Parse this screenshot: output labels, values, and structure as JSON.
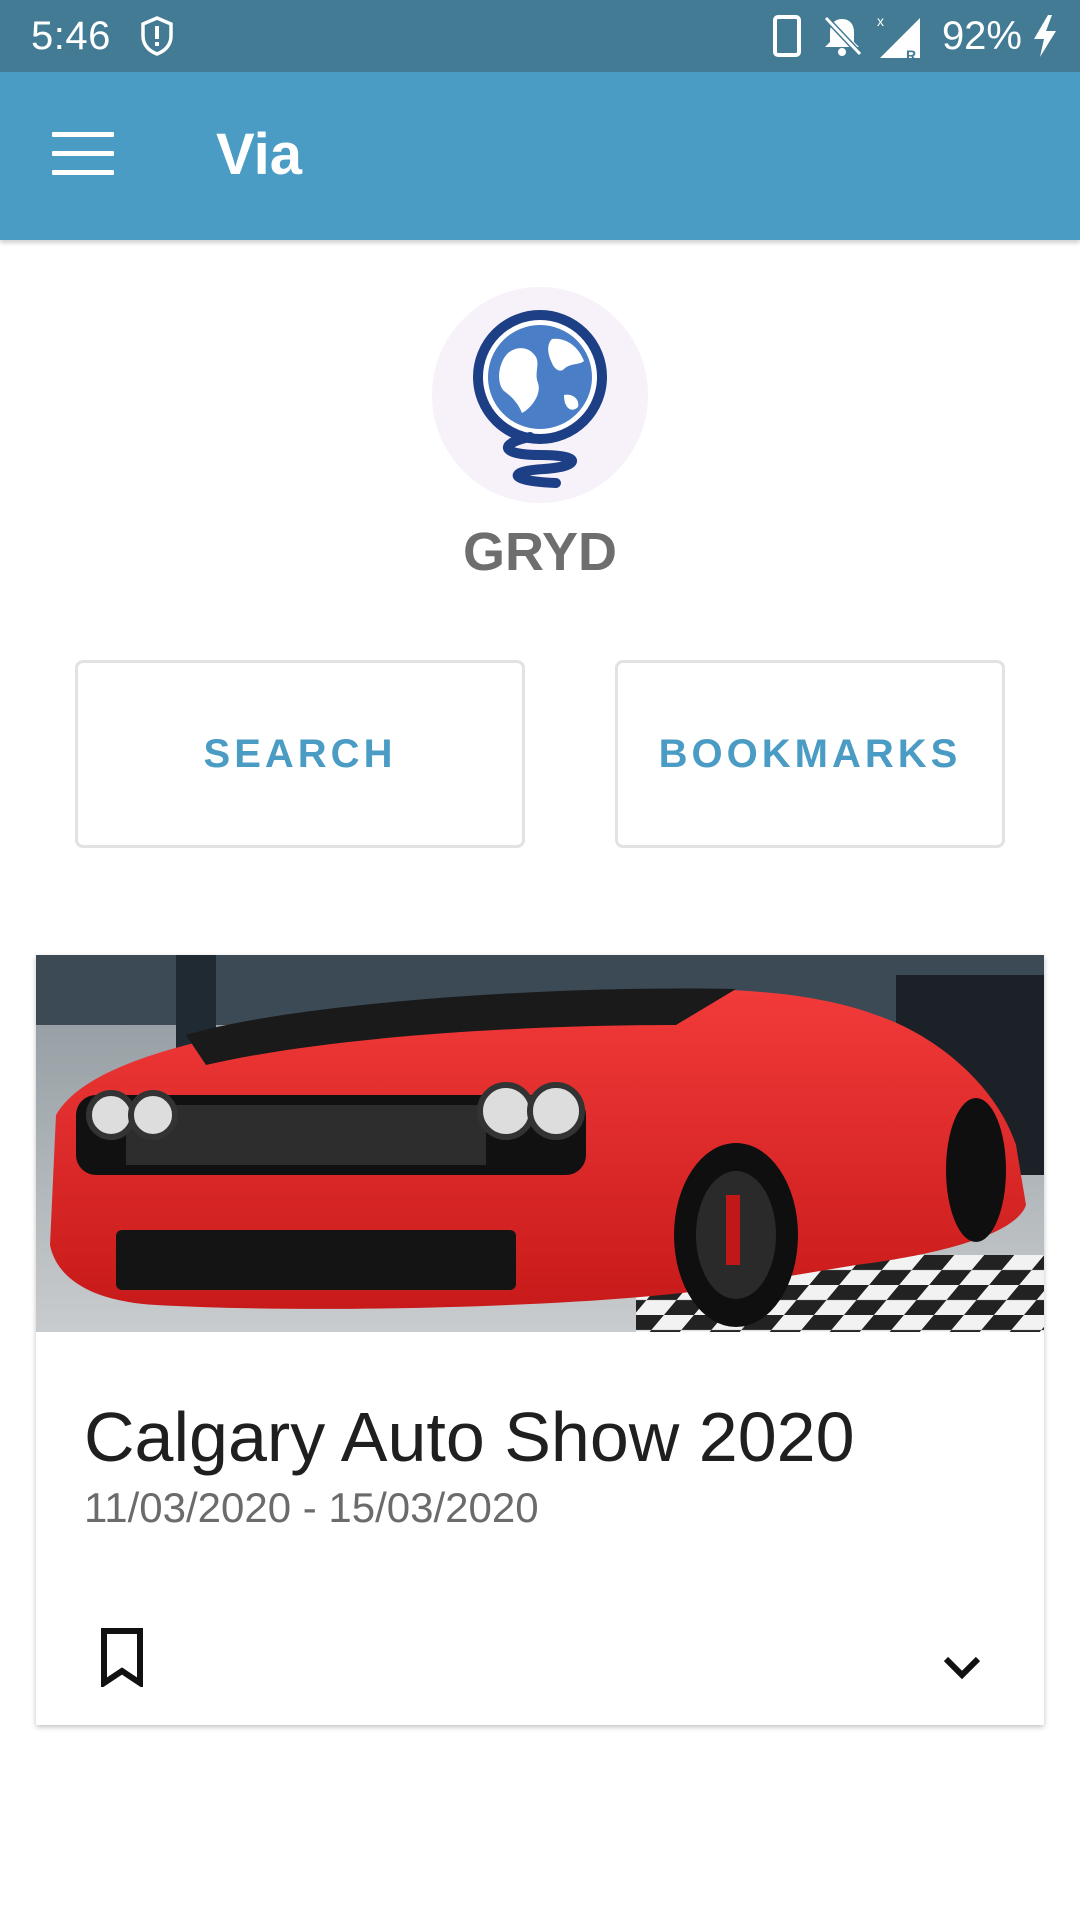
{
  "status_bar": {
    "time": "5:46",
    "battery_percent": "92%",
    "icons": [
      "alert-shield-icon",
      "phone-icon",
      "notifications-off-icon",
      "signal-icon",
      "charging-icon"
    ]
  },
  "app_bar": {
    "title": "Via",
    "menu_icon": "menu-icon",
    "color": "#4b9cc4"
  },
  "brand": {
    "name": "GRYD",
    "logo_icon": "globe-logo-icon"
  },
  "actions": {
    "search_label": "SEARCH",
    "bookmarks_label": "BOOKMARKS",
    "accent_color": "#4b9cc4"
  },
  "event_card": {
    "title": "Calgary Auto Show 2020",
    "dates": "11/03/2020 - 15/03/2020",
    "image": "red-sports-car-photo",
    "bookmark_icon": "bookmark-outline-icon",
    "expand_icon": "chevron-down-icon"
  }
}
